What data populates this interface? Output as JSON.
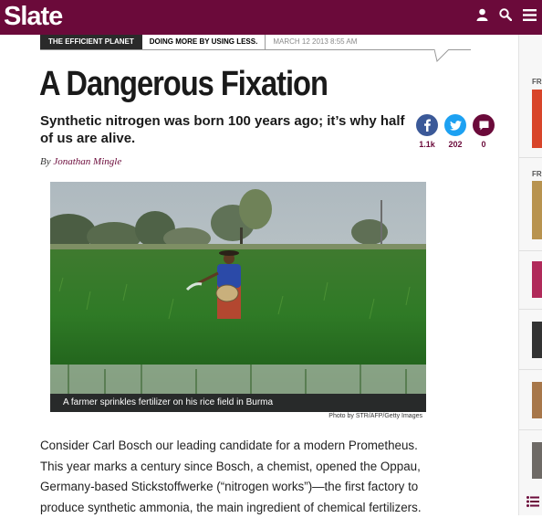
{
  "header": {
    "logo": "Slate",
    "icons": [
      "user-icon",
      "search-icon",
      "menu-icon"
    ],
    "brand_color": "#6b0a3a"
  },
  "kicker": {
    "section": "THE EFFICIENT PLANET",
    "series": "DOING MORE BY USING LESS.",
    "date": "MARCH 12 2013 8:55 AM"
  },
  "article": {
    "headline": "A Dangerous Fixation",
    "dek": "Synthetic nitrogen was born 100 years ago; it’s why half of us are alive.",
    "byline_prefix": "By",
    "author": "Jonathan Mingle",
    "image_caption": "A farmer sprinkles fertilizer on his rice field in Burma",
    "image_credit": "Photo by STR/AFP/Getty Images",
    "body": "Consider Carl Bosch our leading candidate for a modern Prometheus. This year marks a century since Bosch, a chemist, opened the Oppau, Germany-based Stickstoffwerke (“nitrogen works”)—the first factory to produce synthetic ammonia, the main ingredient of chemical fertilizers."
  },
  "shares": [
    {
      "network": "facebook",
      "icon": "facebook-icon",
      "count": "1.1k",
      "color": "#3b5998"
    },
    {
      "network": "twitter",
      "icon": "twitter-icon",
      "count": "202",
      "color": "#1da1f2"
    },
    {
      "network": "comments",
      "icon": "comment-icon",
      "count": "0",
      "color": "#6b0a3a"
    }
  ],
  "rail": {
    "labels": [
      "FR",
      "FR"
    ]
  }
}
